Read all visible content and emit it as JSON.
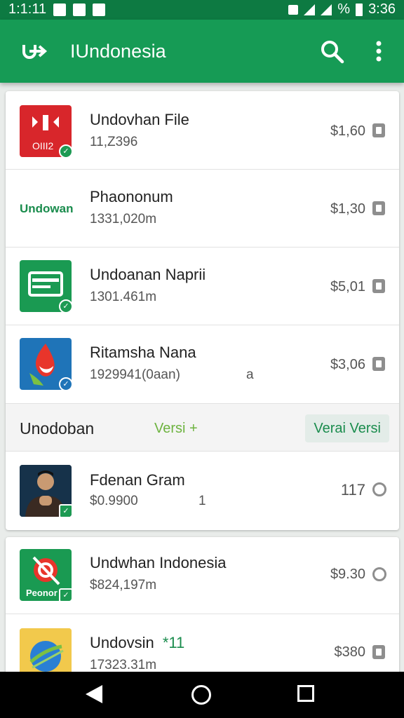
{
  "status_bar": {
    "time_left": "1:1:11",
    "time_right": "3:36",
    "battery_percent": "%"
  },
  "app_bar": {
    "title": "IUndonesia"
  },
  "colors": {
    "primary": "#169b55",
    "status_bar": "#0d7a42",
    "accent": "#6db33f",
    "nav_bar": "#000000"
  },
  "list": {
    "items": [
      {
        "name": "Undovhan File",
        "sub": "11,Z396",
        "price": "$1,60",
        "action_icon": "shopping-bag-icon",
        "icon_text": "OIII2"
      },
      {
        "name": "Phaononum",
        "sub": "1331,020m",
        "price": "$1,30",
        "action_icon": "shopping-bag-icon",
        "icon_text": "Undowan"
      },
      {
        "name": "Undoanan Naprii",
        "sub": "1301.461m",
        "price": "$5,01",
        "action_icon": "shopping-bag-icon"
      },
      {
        "name": "Ritamsha Nana",
        "sub": "1929941(0aan)",
        "extra": "a",
        "price": "$3,06",
        "action_icon": "shopping-bag-icon"
      }
    ],
    "section": {
      "label": "Unodoban",
      "versi": "Versi +",
      "chip": "Verai Versi"
    },
    "items_after_section": [
      {
        "name": "Fdenan Gram",
        "sub": "$0.9900",
        "extra": "1",
        "price": "117",
        "action_icon": "install-icon"
      }
    ]
  },
  "list2": {
    "items": [
      {
        "name": "Undwhan Indonesia",
        "sub": "$824,197m",
        "price": "$9.30",
        "action_icon": "install-icon",
        "icon_text": "Peonor"
      },
      {
        "name": "Undovsin",
        "name_extra": "*11",
        "sub": "17323.31m",
        "price": "$380",
        "action_icon": "shopping-bag-icon"
      }
    ]
  }
}
